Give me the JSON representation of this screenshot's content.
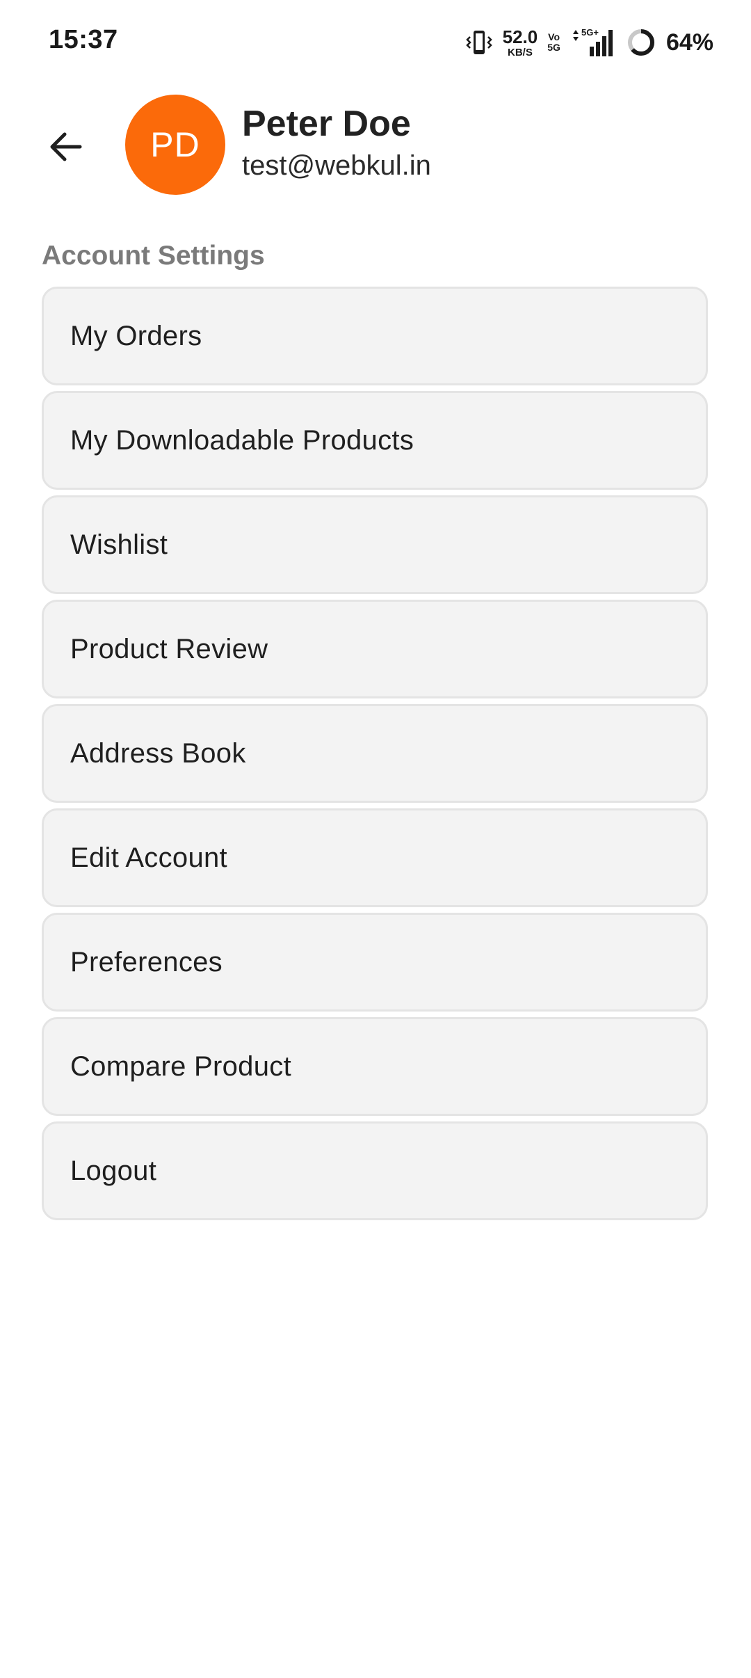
{
  "status_bar": {
    "time": "15:37",
    "net_speed_value": "52.0",
    "net_speed_unit": "KB/S",
    "volte_top": "Vo",
    "volte_bottom": "5G",
    "network_type": "5G+",
    "battery_percent": "64%",
    "battery_level": 0.64
  },
  "header": {
    "avatar_initials": "PD",
    "avatar_color": "#fb6a0a",
    "user_name": "Peter Doe",
    "user_email": "test@webkul.in",
    "back_icon": "arrow-left-icon"
  },
  "section": {
    "title": "Account Settings",
    "items": [
      {
        "label": "My Orders"
      },
      {
        "label": "My Downloadable Products"
      },
      {
        "label": "Wishlist"
      },
      {
        "label": "Product Review"
      },
      {
        "label": "Address Book"
      },
      {
        "label": "Edit Account"
      },
      {
        "label": "Preferences"
      },
      {
        "label": "Compare Product"
      },
      {
        "label": "Logout"
      }
    ]
  }
}
